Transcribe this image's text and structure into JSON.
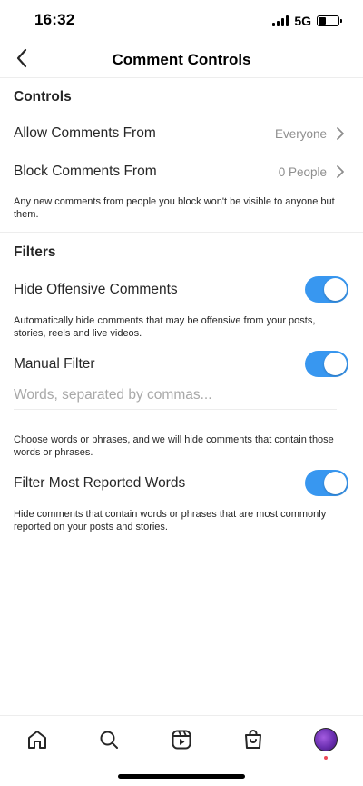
{
  "status_bar": {
    "time": "16:32",
    "network": "5G"
  },
  "header": {
    "title": "Comment Controls"
  },
  "controls": {
    "section_title": "Controls",
    "allow_label": "Allow Comments From",
    "allow_value": "Everyone",
    "block_label": "Block Comments From",
    "block_value": "0 People",
    "block_help": "Any new comments from people you block won't be visible to anyone but them."
  },
  "filters": {
    "section_title": "Filters",
    "hide_offensive": {
      "label": "Hide Offensive Comments",
      "enabled": true,
      "help": "Automatically hide comments that may be offensive from your posts, stories, reels and live videos."
    },
    "manual_filter": {
      "label": "Manual Filter",
      "enabled": true,
      "placeholder": "Words, separated by commas...",
      "value": "",
      "help": "Choose words or phrases, and we will hide comments that contain those words or phrases."
    },
    "most_reported": {
      "label": "Filter Most Reported Words",
      "enabled": true,
      "help": "Hide comments that contain words or phrases that are most commonly reported on your posts and stories."
    }
  },
  "colors": {
    "toggle_on": "#3897f0",
    "notification": "#ed4956"
  },
  "tab_bar": {
    "tabs": [
      "home-icon",
      "search-icon",
      "reels-icon",
      "shop-icon",
      "profile-avatar"
    ]
  }
}
